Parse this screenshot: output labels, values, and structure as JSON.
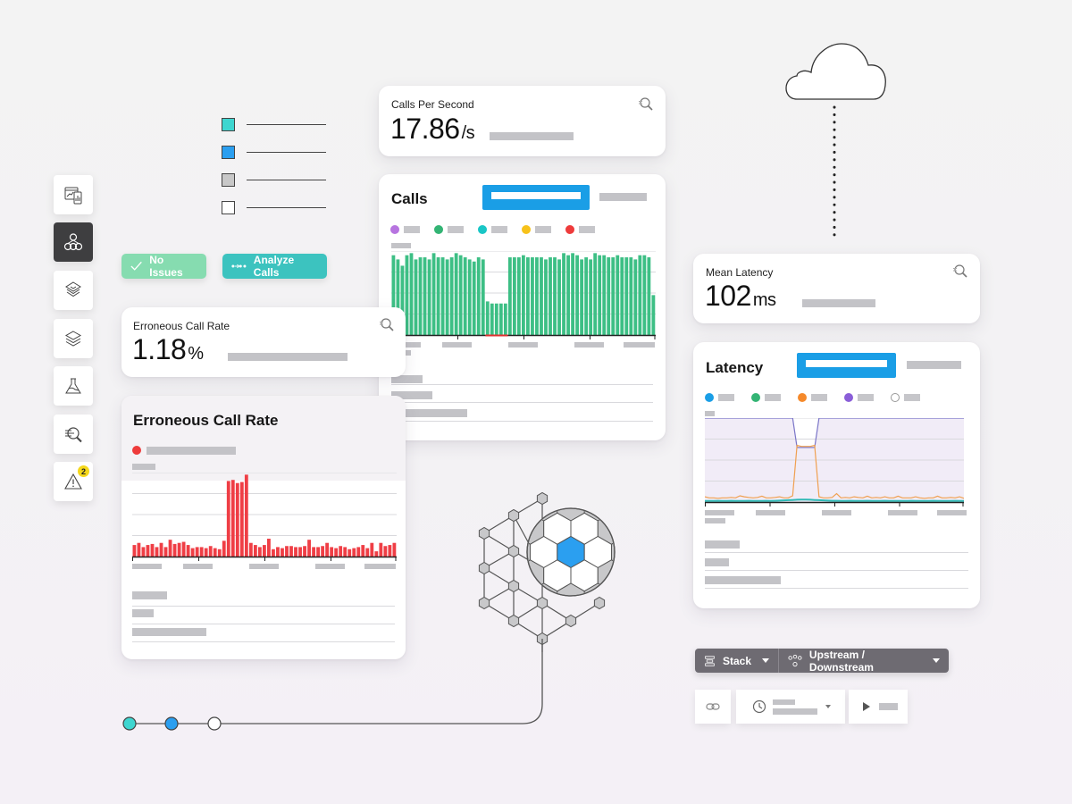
{
  "sidebar": {
    "items": [
      {
        "name": "dashboards",
        "icon": "dashboard-devices-icon",
        "active": false
      },
      {
        "name": "service-map",
        "icon": "hierarchy-icon",
        "active": true
      },
      {
        "name": "layers-view",
        "icon": "layers-diamond-icon",
        "active": false
      },
      {
        "name": "stack",
        "icon": "stack-icon",
        "active": false
      },
      {
        "name": "lab",
        "icon": "flask-icon",
        "active": false
      },
      {
        "name": "analyze",
        "icon": "analyze-search-icon",
        "active": false
      },
      {
        "name": "alerts",
        "icon": "warning-icon",
        "active": false,
        "badge": "2"
      }
    ]
  },
  "legend_swatches": [
    {
      "color": "#3ed6d0"
    },
    {
      "color": "#2b9ff0"
    },
    {
      "color": "#c8c8c8"
    },
    {
      "color": "#ffffff"
    }
  ],
  "status_pills": {
    "no_issues": {
      "label": "No Issues",
      "icon": "checkmark-icon",
      "color": "#7fd7a8"
    },
    "analyze_calls": {
      "label": "Analyze Calls",
      "icon": "trace-dots-icon",
      "color": "#3cc3bf"
    }
  },
  "kpis": {
    "calls_per_second": {
      "label": "Calls Per Second",
      "value": "17.86",
      "unit": "/s"
    },
    "erroneous_call_rate": {
      "label": "Erroneous Call Rate",
      "value": "1.18",
      "unit": "%"
    },
    "mean_latency": {
      "label": "Mean Latency",
      "value": "102",
      "unit": "ms"
    }
  },
  "charts": {
    "calls": {
      "title": "Calls",
      "legend_colors": [
        "#b774e0",
        "#33b474",
        "#19c6c6",
        "#f7c21a",
        "#ee3b3b"
      ],
      "bar_color": "#3dbf85"
    },
    "errors": {
      "title": "Erroneous Call Rate",
      "legend_colors": [
        "#ee3b3b"
      ],
      "bar_color": "#ef3e45"
    },
    "latency": {
      "title": "Latency",
      "legend_colors": [
        "#1a9ee6",
        "#33b474",
        "#f5892a",
        "#8a5ed8",
        "#ffffff"
      ]
    }
  },
  "chart_data": [
    {
      "type": "bar",
      "title": "Calls",
      "ylim": [
        0,
        4
      ],
      "values": [
        3.8,
        3.6,
        3.3,
        3.8,
        3.9,
        3.6,
        3.7,
        3.7,
        3.6,
        3.9,
        3.7,
        3.7,
        3.6,
        3.7,
        3.9,
        3.8,
        3.7,
        3.6,
        3.5,
        3.7,
        3.6,
        1.6,
        1.5,
        1.5,
        1.5,
        1.5,
        3.7,
        3.7,
        3.7,
        3.8,
        3.7,
        3.7,
        3.7,
        3.7,
        3.6,
        3.7,
        3.7,
        3.6,
        3.9,
        3.8,
        3.9,
        3.8,
        3.6,
        3.7,
        3.6,
        3.9,
        3.8,
        3.8,
        3.7,
        3.7,
        3.8,
        3.7,
        3.7,
        3.7,
        3.6,
        3.8,
        3.8,
        3.7,
        1.9
      ]
    },
    {
      "type": "bar",
      "title": "Erroneous Call Rate",
      "ylim": [
        0,
        4
      ],
      "values": [
        0.55,
        0.65,
        0.45,
        0.55,
        0.6,
        0.45,
        0.65,
        0.45,
        0.8,
        0.6,
        0.65,
        0.7,
        0.55,
        0.4,
        0.45,
        0.45,
        0.4,
        0.5,
        0.4,
        0.35,
        0.75,
        3.6,
        3.65,
        3.5,
        3.55,
        3.9,
        0.65,
        0.55,
        0.45,
        0.55,
        0.85,
        0.35,
        0.45,
        0.4,
        0.5,
        0.5,
        0.45,
        0.45,
        0.5,
        0.8,
        0.45,
        0.45,
        0.5,
        0.65,
        0.45,
        0.4,
        0.5,
        0.45,
        0.35,
        0.4,
        0.45,
        0.55,
        0.4,
        0.65,
        0.25,
        0.65,
        0.5,
        0.55,
        0.65
      ]
    },
    {
      "type": "line",
      "title": "Latency",
      "ylim": [
        0,
        4
      ],
      "series": [
        {
          "name": "purple",
          "color": "#7b76c8",
          "values": [
            4,
            4,
            4,
            4,
            4,
            4,
            4,
            4,
            4,
            4,
            4,
            4,
            4,
            4,
            4,
            4,
            4,
            4,
            4,
            4,
            4,
            2.6,
            2.6,
            2.6,
            2.6,
            2.6,
            4,
            4,
            4,
            4,
            4,
            4,
            4,
            4,
            4,
            4,
            4,
            4,
            4,
            4,
            4,
            4,
            4,
            4,
            4,
            4,
            4,
            4,
            4,
            4,
            4,
            4,
            4,
            4,
            4,
            4,
            4,
            4,
            4,
            4
          ]
        },
        {
          "name": "orange",
          "color": "#f0a050",
          "values": [
            0.25,
            0.2,
            0.2,
            0.18,
            0.2,
            0.2,
            0.22,
            0.2,
            0.3,
            0.25,
            0.22,
            0.2,
            0.22,
            0.28,
            0.2,
            0.2,
            0.22,
            0.25,
            0.2,
            0.2,
            0.3,
            2.7,
            2.65,
            2.65,
            2.65,
            2.7,
            0.25,
            0.2,
            0.2,
            0.22,
            0.4,
            0.2,
            0.22,
            0.2,
            0.25,
            0.22,
            0.2,
            0.28,
            0.2,
            0.22,
            0.2,
            0.25,
            0.2,
            0.2,
            0.28,
            0.2,
            0.2,
            0.2,
            0.25,
            0.2,
            0.18,
            0.2,
            0.2,
            0.28,
            0.2,
            0.2,
            0.22,
            0.2,
            0.25,
            0.18
          ]
        },
        {
          "name": "teal",
          "color": "#2db9b5",
          "values": [
            0.05,
            0.05,
            0.05,
            0.06,
            0.05,
            0.05,
            0.06,
            0.05,
            0.05,
            0.05,
            0.06,
            0.05,
            0.05,
            0.05,
            0.06,
            0.05,
            0.06,
            0.07,
            0.08,
            0.09,
            0.1,
            0.11,
            0.12,
            0.12,
            0.11,
            0.1,
            0.09,
            0.08,
            0.07,
            0.06,
            0.06,
            0.05,
            0.05,
            0.06,
            0.05,
            0.05,
            0.05,
            0.06,
            0.05,
            0.05,
            0.05,
            0.06,
            0.05,
            0.05,
            0.05,
            0.05,
            0.05,
            0.06,
            0.05,
            0.05,
            0.05,
            0.05,
            0.06,
            0.05,
            0.05,
            0.05,
            0.05,
            0.06,
            0.05,
            0.05
          ]
        }
      ]
    }
  ],
  "toolbar": {
    "stack_label": "Stack",
    "upstream_label": "Upstream / Downstream"
  },
  "timeline_nodes": [
    {
      "color": "#3ed6d0"
    },
    {
      "color": "#2b9ff0"
    },
    {
      "color": "#ffffff"
    }
  ]
}
